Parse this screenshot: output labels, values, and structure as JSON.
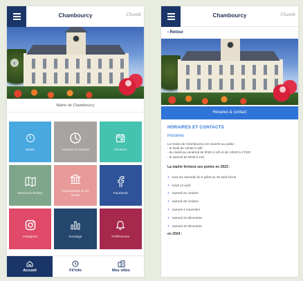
{
  "colors": {
    "navy": "#1a3567",
    "accent_blue": "#2e74d9",
    "background": "#e9ece1"
  },
  "left_screen": {
    "header": {
      "title": "Chambourcy",
      "signature": "Chamb"
    },
    "photo_caption": "Mairie de Chambourcy",
    "tiles": [
      {
        "label": "Mairie",
        "color": "#48a8e0",
        "icon": "info-icon"
      },
      {
        "label": "Horaires & contact",
        "color": "#a6a3a0",
        "icon": "clock-icon"
      },
      {
        "label": "Services",
        "color": "#45c2b0",
        "icon": "calendar-icon"
      },
      {
        "label": "Découvrir Roissy",
        "color": "#7fa58b",
        "icon": "map-icon"
      },
      {
        "label": "Associations & Vie locale",
        "color": "#e79a99",
        "icon": "building-icon"
      },
      {
        "label": "Facebook",
        "color": "#2f5398",
        "icon": "facebook-icon"
      },
      {
        "label": "Instagram",
        "color": "#e14968",
        "icon": "instagram-icon"
      },
      {
        "label": "Sondage",
        "color": "#25466d",
        "icon": "chart-icon"
      },
      {
        "label": "Préférences",
        "color": "#a6284c",
        "icon": "bell-icon"
      }
    ],
    "tabs": [
      {
        "label": "Accueil",
        "icon": "home-icon",
        "active": true
      },
      {
        "label": "Fil'info",
        "icon": "clock-icon",
        "active": false
      },
      {
        "label": "Mes villes",
        "icon": "buildings-icon",
        "active": false
      }
    ]
  },
  "right_screen": {
    "header": {
      "title": "Chambourcy",
      "signature": "Chamb"
    },
    "back_label": "‹ Retour",
    "button_label": "Horaires & contact",
    "section_title": "HORAIRES ET CONTACTS",
    "subtitle": "Horaires",
    "intro_lines": [
      "La mairie de Chambourcy est ouverte au public :",
      "- le lundi de 13h30 à 18h",
      "- du mardi au vendredi de 8h30 à 12h et de 13h30 à 17h30",
      "- le samedi de 8h30 à 12h"
    ],
    "closure_title": "La mairie fermera ses portes en 2023 :",
    "closure_items": [
      "tous les samedis du 8 juillet au 26 août inclus",
      "lundi 14 août",
      "samedi 21 octobre",
      "samedi 28 octobre",
      "samedi 4 novembre",
      "samedi 23 décembre",
      "samedi 30 décembre"
    ],
    "next_year_label": "en 2024 :"
  }
}
